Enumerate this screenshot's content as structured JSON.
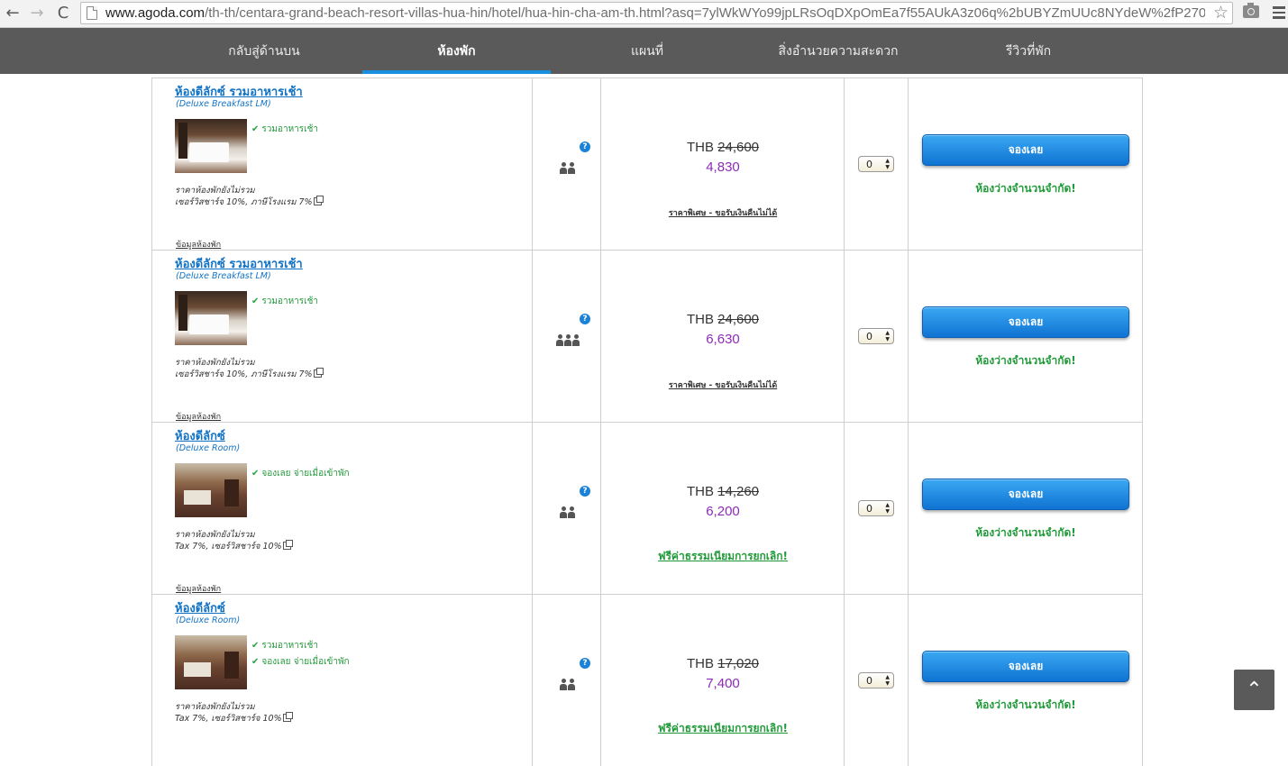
{
  "browser": {
    "url_host": "www.agoda.com",
    "url_path": "/th-th/centara-grand-beach-resort-villas-hua-hin/hotel/hua-hin-cha-am-th.html?asq=7ylWkWYo99jpLRsOqDXpOmEa7f55AUkA3z06q%2bUBYZmUUc8NYdeW%2fP270...",
    "back_glyph": "←",
    "forward_glyph": "→",
    "reload_glyph": "C",
    "star_glyph": "☆"
  },
  "site_nav": {
    "tabs": [
      {
        "label": "กลับสู่ด้านบน"
      },
      {
        "label": "ห้องพัก"
      },
      {
        "label": "แผนที่"
      },
      {
        "label": "สิ่งอำนวยความสะดวก"
      },
      {
        "label": "รีวิวที่พัก"
      }
    ],
    "active_tab": "ห้องพัก"
  },
  "rooms": [
    {
      "title": "ห้องดีลักซ์ รวมอาหารเช้า",
      "subtitle": "(Deluxe Breakfast LM)",
      "image": "breakfast",
      "perks": [
        "รวมอาหารเช้า"
      ],
      "note_line1": "ราคาห้องพักยังไม่รวม",
      "note_line2": "เซอร์วิสชาร์จ 10%, ภาษีโรงแรม 7%",
      "info_link": "ข้อมูลห้องพัก",
      "guests": 2,
      "currency": "THB",
      "original_price": "24,600",
      "price": "4,830",
      "price_note": "ราคาพิเศษ - ขอรับเงินคืนไม่ได้",
      "qty": "0",
      "book_label": "จองเลย",
      "availability": "ห้องว่างจำนวนจำกัด!"
    },
    {
      "title": "ห้องดีลักซ์ รวมอาหารเช้า",
      "subtitle": "(Deluxe Breakfast LM)",
      "image": "breakfast",
      "perks": [
        "รวมอาหารเช้า"
      ],
      "note_line1": "ราคาห้องพักยังไม่รวม",
      "note_line2": "เซอร์วิสชาร์จ 10%, ภาษีโรงแรม 7%",
      "info_link": "ข้อมูลห้องพัก",
      "guests": 3,
      "currency": "THB",
      "original_price": "24,600",
      "price": "6,630",
      "price_note": "ราคาพิเศษ - ขอรับเงินคืนไม่ได้",
      "qty": "0",
      "book_label": "จองเลย",
      "availability": "ห้องว่างจำนวนจำกัด!"
    },
    {
      "title": "ห้องดีลักซ์",
      "subtitle": "(Deluxe Room)",
      "image": "deluxe",
      "perks": [
        "จองเลย จ่ายเมื่อเข้าพัก"
      ],
      "note_line1": "ราคาห้องพักยังไม่รวม",
      "note_line2": "Tax 7%, เซอร์วิสชาร์จ 10%",
      "info_link": "ข้อมูลห้องพัก",
      "guests": 2,
      "currency": "THB",
      "original_price": "14,260",
      "price": "6,200",
      "price_note": "ฟรีค่าธรรมเนียมการยกเลิก!",
      "qty": "0",
      "book_label": "จองเลย",
      "availability": "ห้องว่างจำนวนจำกัด!"
    },
    {
      "title": "ห้องดีลักซ์",
      "subtitle": "(Deluxe Room)",
      "image": "deluxe",
      "perks": [
        "รวมอาหารเช้า",
        "จองเลย จ่ายเมื่อเข้าพัก"
      ],
      "note_line1": "ราคาห้องพักยังไม่รวม",
      "note_line2": "Tax 7%, เซอร์วิสชาร์จ 10%",
      "info_link": "ข้อมูลห้องพัก",
      "guests": 2,
      "currency": "THB",
      "original_price": "17,020",
      "price": "7,400",
      "price_note": "ฟรีค่าธรรมเนียมการยกเลิก!",
      "qty": "0",
      "book_label": "จองเลย",
      "availability": "ห้องว่างจำนวนจำกัด!"
    }
  ],
  "help_glyph": "?",
  "check_glyph": "✔",
  "scroll_top_glyph": "⌃"
}
